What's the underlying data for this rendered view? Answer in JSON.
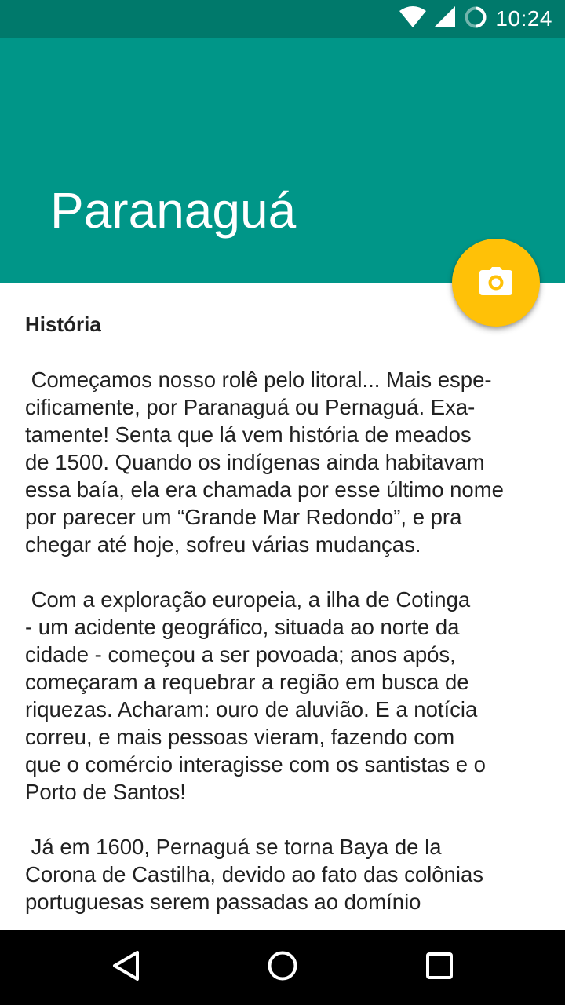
{
  "status_bar": {
    "time": "10:24",
    "icons": [
      "wifi-icon",
      "signal-icon",
      "sync-icon"
    ]
  },
  "app_bar": {
    "title": "Paranaguá",
    "color": "#009688",
    "status_color": "#00796b"
  },
  "fab": {
    "icon": "camera-icon",
    "color": "#ffc107"
  },
  "content": {
    "heading": "História",
    "paragraphs": [
      [
        " Começamos nosso rolê pelo litoral... Mais espe-",
        "cificamente, por Paranaguá ou Pernaguá. Exa-",
        "tamente! Senta que lá vem história de meados",
        "de 1500. Quando os indígenas ainda habitavam",
        "essa baía, ela era chamada por esse último nome",
        "por parecer um “Grande Mar Redondo”, e pra",
        "chegar até hoje, sofreu várias mudanças."
      ],
      [
        " Com a exploração europeia, a ilha de Cotinga",
        "- um acidente geográfico, situada ao norte da",
        "cidade - começou a ser povoada; anos após,",
        "começaram a requebrar a região em busca de",
        "riquezas. Acharam: ouro de aluvião. E a notícia",
        "correu, e mais pessoas vieram, fazendo com",
        "que o comércio interagisse com os santistas e o",
        "Porto de Santos!"
      ],
      [
        " Já em 1600, Pernaguá se torna Baya de la",
        "Corona de Castilha, devido ao fato das colônias",
        "portuguesas serem passadas ao domínio"
      ]
    ]
  },
  "nav_bar": {
    "buttons": [
      "back-icon",
      "home-icon",
      "recents-icon"
    ]
  }
}
